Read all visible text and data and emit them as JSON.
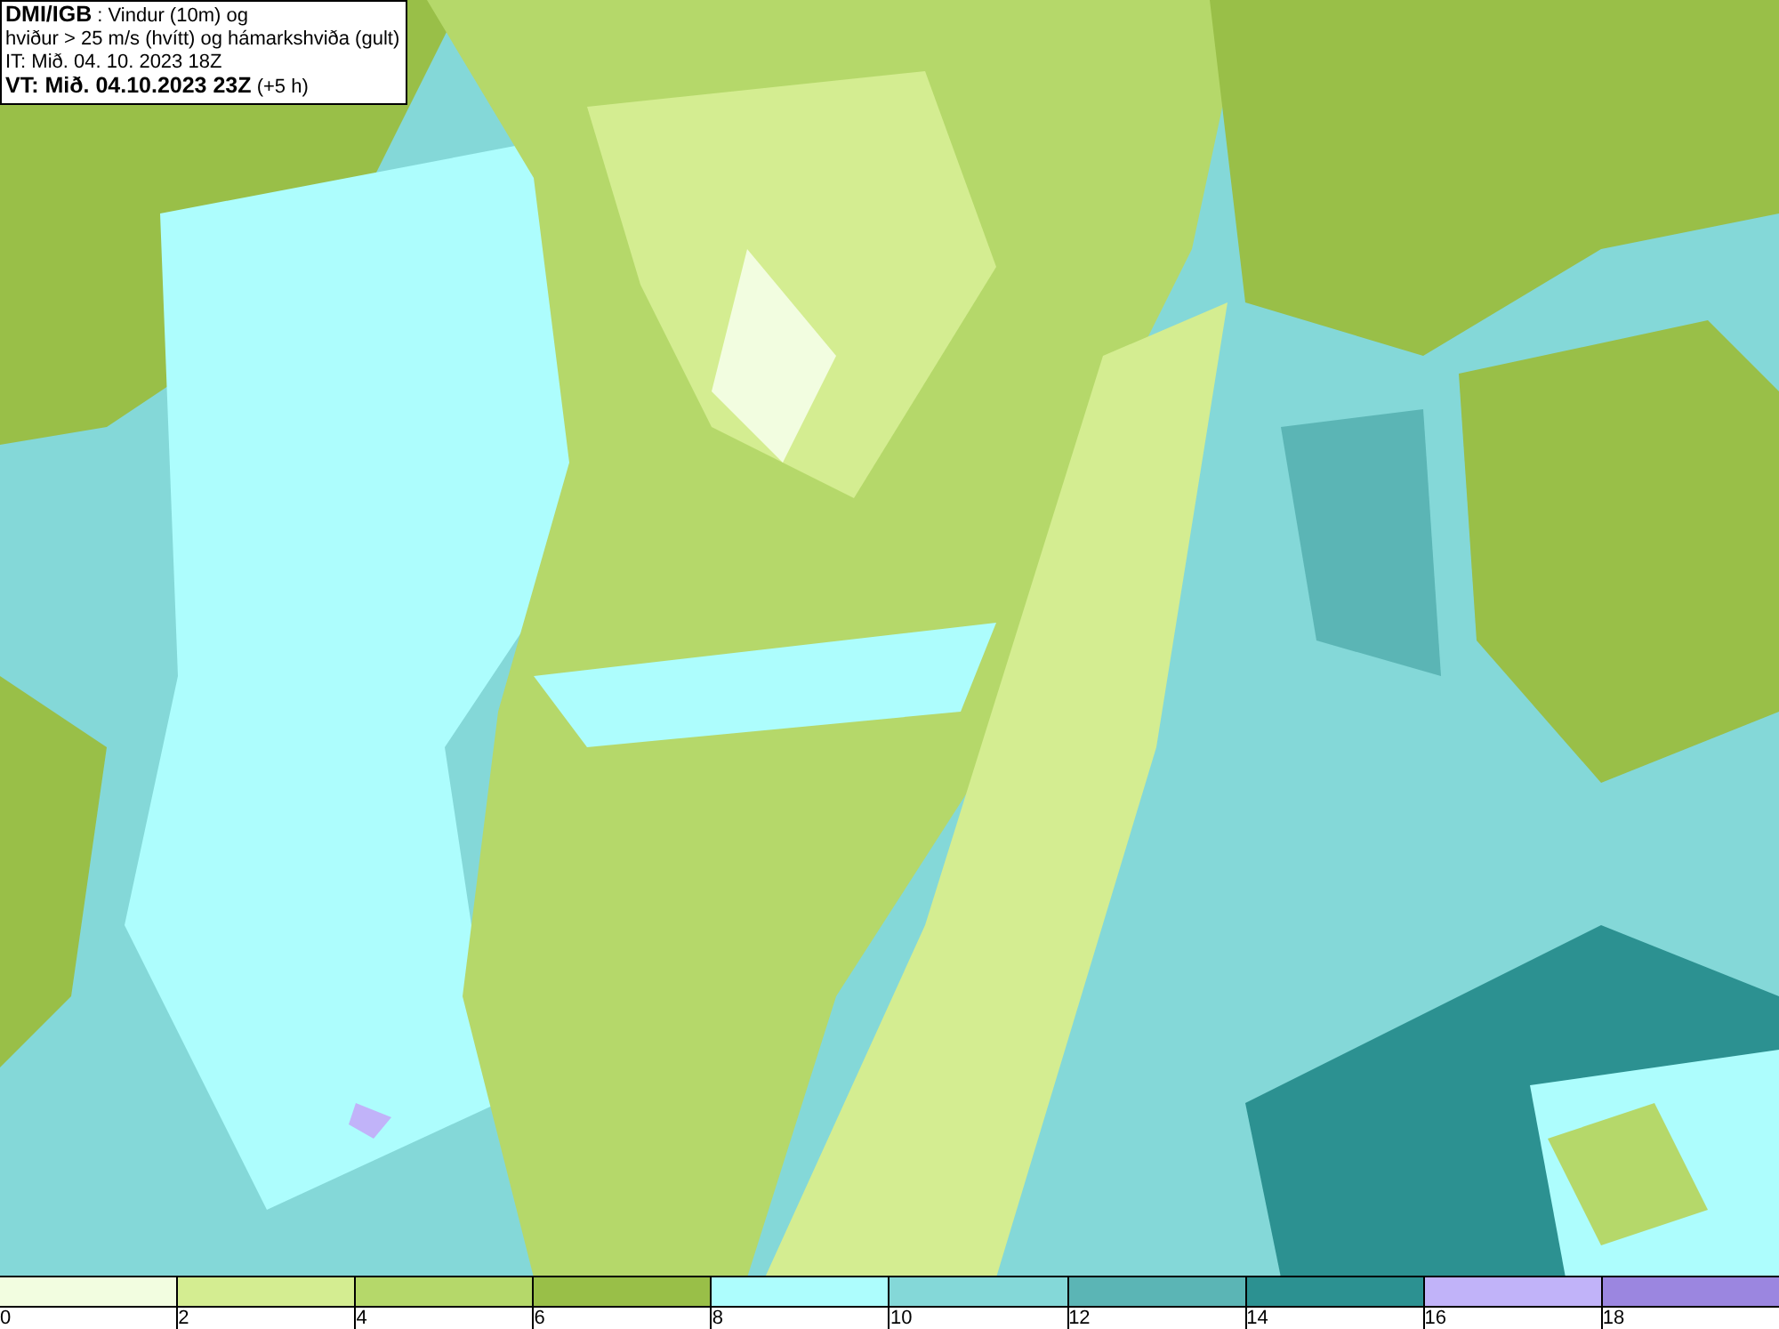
{
  "header": {
    "lines": [
      "**DMI/IGB** : Vindur (10m) og",
      "hviður > 25 m/s (hvítt) og hámarkshviða (gult)",
      "IT: Mið. 04. 10. 2023 18Z",
      "**VT: Mið. 04.10.2023 23Z** (+5 h)"
    ]
  },
  "legend": {
    "bins": [
      {
        "color": "#f2fde0",
        "label": "0"
      },
      {
        "color": "#d4ed91",
        "label": "2"
      },
      {
        "color": "#b5d86a",
        "label": "4"
      },
      {
        "color": "#99bf48",
        "label": "6"
      },
      {
        "color": "#adfdfd",
        "label": "8"
      },
      {
        "color": "#84d8d8",
        "label": "10"
      },
      {
        "color": "#5bb5b5",
        "label": "12"
      },
      {
        "color": "#2c9191",
        "label": "14"
      },
      {
        "color": "#c1b3f9",
        "label": "16"
      },
      {
        "color": "#9b86e0",
        "label": "18"
      }
    ]
  }
}
